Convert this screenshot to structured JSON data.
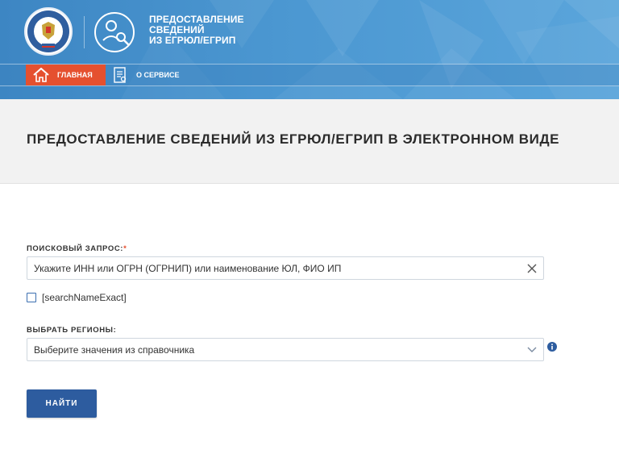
{
  "header": {
    "service_title_lines": [
      "ПРЕДОСТАВЛЕНИЕ",
      "СВЕДЕНИЙ",
      "ИЗ ЕГРЮЛ/ЕГРИП"
    ],
    "colors": {
      "banner": "#4b97d1",
      "accent": "#e5502f",
      "primary": "#2d5c9f"
    }
  },
  "nav": {
    "home_label": "ГЛАВНАЯ",
    "about_label": "О СЕРВИСЕ"
  },
  "page": {
    "title": "ПРЕДОСТАВЛЕНИЕ СВЕДЕНИЙ ИЗ ЕГРЮЛ/ЕГРИП В ЭЛЕКТРОННОМ ВИДЕ"
  },
  "form": {
    "query_label": "ПОИСКОВЫЙ ЗАПРОС:",
    "required_mark": "*",
    "query_placeholder": "Укажите ИНН или ОГРН (ОГРНИП) или наименование ЮЛ, ФИО ИП",
    "query_value": "",
    "exact_checkbox_label": "[searchNameExact]",
    "exact_checked": false,
    "regions_label": "ВЫБРАТЬ РЕГИОНЫ:",
    "regions_placeholder": "Выберите значения из справочника",
    "submit_label": "НАЙТИ"
  },
  "icons": {
    "emblem": "fns-emblem-icon",
    "service": "service-inspector-icon",
    "home": "home-icon",
    "about": "document-icon",
    "clear": "close-icon",
    "dropdown": "chevron-down-icon",
    "info": "info-icon"
  }
}
